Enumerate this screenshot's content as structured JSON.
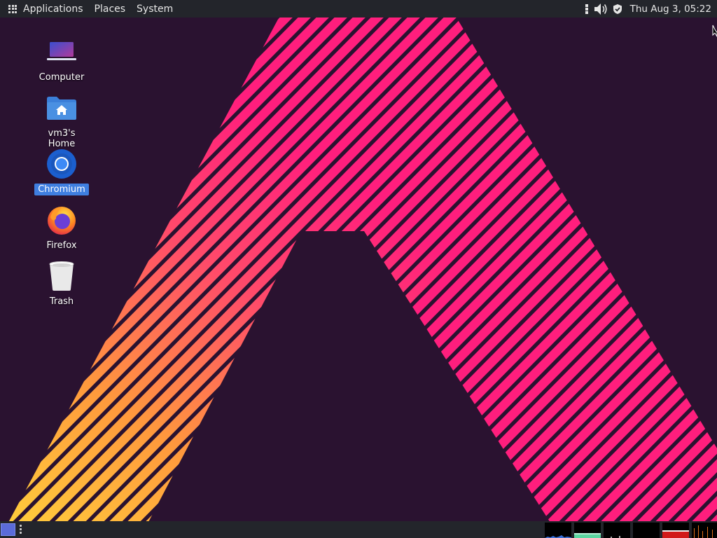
{
  "top_panel": {
    "menus": [
      "Applications",
      "Places",
      "System"
    ],
    "clock": "Thu Aug  3, 05:22",
    "tray_icons": [
      "notifications-icon",
      "volume-icon",
      "shield-icon"
    ]
  },
  "desktop": {
    "icons": [
      {
        "label": "Computer",
        "icon": "computer-icon",
        "selected": false
      },
      {
        "label": "vm3's Home",
        "icon": "home-folder-icon",
        "selected": false
      },
      {
        "label": "Chromium",
        "icon": "chromium-icon",
        "selected": true
      },
      {
        "label": "Firefox",
        "icon": "firefox-icon",
        "selected": false
      },
      {
        "label": "Trash",
        "icon": "trash-icon",
        "selected": false
      }
    ]
  },
  "colors": {
    "background": "#2a1230",
    "panel": "#23252b",
    "stripe_pink": "#ff1e7d",
    "stripe_orange": "#ff9a3c",
    "stripe_yellow": "#ffd23c",
    "selection": "#3f7fe0"
  }
}
